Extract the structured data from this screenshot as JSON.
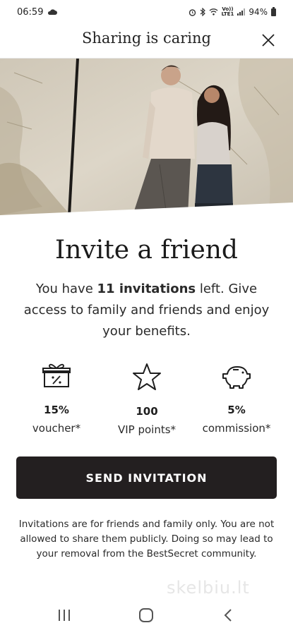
{
  "status_bar": {
    "time": "06:59",
    "net_label_top": "Vo))",
    "net_label_bottom": "LTE1",
    "battery": "94%"
  },
  "header": {
    "title": "Sharing is caring",
    "close_icon": "close-icon"
  },
  "hero": {
    "description_icon": "hero-photo"
  },
  "invite": {
    "heading": "Invite a friend",
    "intro_before": "You have ",
    "intro_count": "11 invitations",
    "intro_after": " left. Give access to family and friends and enjoy your benefits."
  },
  "benefits": [
    {
      "icon": "gift-percent-icon",
      "value": "15%",
      "label": "voucher*"
    },
    {
      "icon": "star-icon",
      "value": "100",
      "label": "VIP points*"
    },
    {
      "icon": "piggy-bank-icon",
      "value": "5%",
      "label": "commission*"
    }
  ],
  "cta": {
    "label": "SEND INVITATION"
  },
  "disclaimer": "Invitations are for friends and family only. You are not allowed to share them publicly. Doing so may lead to your removal from the BestSecret community.",
  "watermark": "skelbiu.lt",
  "nav": {
    "recents_icon": "recents-icon",
    "home_icon": "home-icon",
    "back_icon": "back-icon"
  },
  "colors": {
    "cta_background": "#231f20",
    "cta_text": "#ffffff",
    "text": "#1f1f1f"
  }
}
